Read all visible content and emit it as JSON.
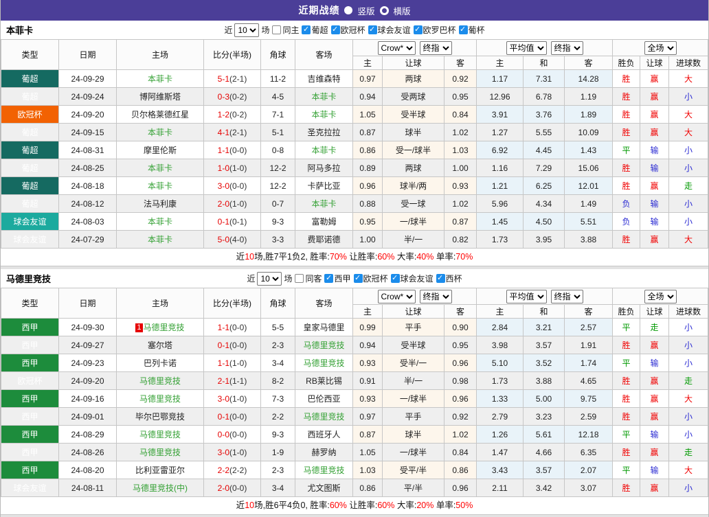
{
  "titlebar": {
    "title": "近期战绩",
    "radio_vertical": "竖版",
    "radio_horizontal": "横版"
  },
  "colors": {
    "titlebar_purple": "#4b3e98",
    "league_pt": "#156a61",
    "ucl_orange": "#f26202",
    "friendly_teal": "#1caa9e",
    "laliga_green": "#1d8c3c",
    "win_red": "#f00000",
    "draw_green": "#009900",
    "lose_blue": "#2a2ad2",
    "score_red": "#e60000",
    "team_green": "#33a033",
    "checkbox_blue": "#1b8ceb",
    "odds_cream_bg": "#fdf6ec",
    "avg_blue_bg": "#e9f3f9",
    "alt_row_bg": "#efefef"
  },
  "common": {
    "filter_prefix": "近",
    "filter_suffix": "场",
    "col_headers": {
      "type": "类型",
      "date": "日期",
      "home": "主场",
      "score": "比分(半场)",
      "corner": "角球",
      "away": "客场",
      "let_home": "主",
      "let": "让球",
      "let_away": "客",
      "avg_home": "主",
      "avg_draw": "和",
      "avg_away": "客",
      "result_wdl": "胜负",
      "result_let": "让球",
      "result_goals": "进球数"
    },
    "selects": {
      "rounds": "10",
      "odds_source": "Crow*",
      "odds_stage": "终指",
      "avg_source": "平均值",
      "avg_stage": "终指",
      "scope": "全场"
    }
  },
  "benfica": {
    "team": "本菲卡",
    "same_label": "同主",
    "leagues": [
      "葡超",
      "欧冠杯",
      "球会友谊",
      "欧罗巴杯",
      "葡杯"
    ],
    "rows": [
      {
        "t": "葡超",
        "tc": "t-pu",
        "d": "24-09-29",
        "h": "本菲卡",
        "hc": "tm-g",
        "bg": "",
        "s": "5-1",
        "hf": "(2-1)",
        "cn": "11-2",
        "a": "吉维森特",
        "ac": "",
        "o1": "0.97",
        "o2": "两球",
        "o3": "0.92",
        "v1": "1.17",
        "v2": "7.31",
        "v3": "14.28",
        "r1": "胜",
        "r1c": "c-r",
        "r2": "赢",
        "r2c": "c-r",
        "r3": "大",
        "r3c": "c-r"
      },
      {
        "t": "葡超",
        "tc": "t-pu",
        "d": "24-09-24",
        "h": "博阿维斯塔",
        "hc": "",
        "bg": "",
        "s": "0-3",
        "hf": "(0-2)",
        "cn": "4-5",
        "a": "本菲卡",
        "ac": "tm-g",
        "o1": "0.94",
        "o2": "受两球",
        "o3": "0.95",
        "v1": "12.96",
        "v2": "6.78",
        "v3": "1.19",
        "r1": "胜",
        "r1c": "c-r",
        "r2": "赢",
        "r2c": "c-r",
        "r3": "小",
        "r3c": "c-b"
      },
      {
        "t": "欧冠杯",
        "tc": "t-ucl",
        "d": "24-09-20",
        "h": "贝尔格莱德红星",
        "hc": "",
        "bg": "",
        "s": "1-2",
        "hf": "(0-2)",
        "cn": "7-1",
        "a": "本菲卡",
        "ac": "tm-g",
        "o1": "1.05",
        "o2": "受半球",
        "o3": "0.84",
        "v1": "3.91",
        "v2": "3.76",
        "v3": "1.89",
        "r1": "胜",
        "r1c": "c-r",
        "r2": "赢",
        "r2c": "c-r",
        "r3": "大",
        "r3c": "c-r"
      },
      {
        "t": "葡超",
        "tc": "t-pu",
        "d": "24-09-15",
        "h": "本菲卡",
        "hc": "tm-g",
        "bg": "",
        "s": "4-1",
        "hf": "(2-1)",
        "cn": "5-1",
        "a": "圣克拉拉",
        "ac": "",
        "o1": "0.87",
        "o2": "球半",
        "o3": "1.02",
        "v1": "1.27",
        "v2": "5.55",
        "v3": "10.09",
        "r1": "胜",
        "r1c": "c-r",
        "r2": "赢",
        "r2c": "c-r",
        "r3": "大",
        "r3c": "c-r"
      },
      {
        "t": "葡超",
        "tc": "t-pu",
        "d": "24-08-31",
        "h": "摩里伦斯",
        "hc": "",
        "bg": "",
        "s": "1-1",
        "hf": "(0-0)",
        "cn": "0-8",
        "a": "本菲卡",
        "ac": "tm-g",
        "o1": "0.86",
        "o2": "受一/球半",
        "o3": "1.03",
        "v1": "6.92",
        "v2": "4.45",
        "v3": "1.43",
        "r1": "平",
        "r1c": "c-g",
        "r2": "输",
        "r2c": "c-b",
        "r3": "小",
        "r3c": "c-b"
      },
      {
        "t": "葡超",
        "tc": "t-pu",
        "d": "24-08-25",
        "h": "本菲卡",
        "hc": "tm-g",
        "bg": "",
        "s": "1-0",
        "hf": "(1-0)",
        "cn": "12-2",
        "a": "阿马多拉",
        "ac": "",
        "o1": "0.89",
        "o2": "两球",
        "o3": "1.00",
        "v1": "1.16",
        "v2": "7.29",
        "v3": "15.06",
        "r1": "胜",
        "r1c": "c-r",
        "r2": "输",
        "r2c": "c-b",
        "r3": "小",
        "r3c": "c-b"
      },
      {
        "t": "葡超",
        "tc": "t-pu",
        "d": "24-08-18",
        "h": "本菲卡",
        "hc": "tm-g",
        "bg": "",
        "s": "3-0",
        "hf": "(0-0)",
        "cn": "12-2",
        "a": "卡萨比亚",
        "ac": "",
        "o1": "0.96",
        "o2": "球半/两",
        "o3": "0.93",
        "v1": "1.21",
        "v2": "6.25",
        "v3": "12.01",
        "r1": "胜",
        "r1c": "c-r",
        "r2": "赢",
        "r2c": "c-r",
        "r3": "走",
        "r3c": "c-g"
      },
      {
        "t": "葡超",
        "tc": "t-pu",
        "d": "24-08-12",
        "h": "法马利康",
        "hc": "",
        "bg": "",
        "s": "2-0",
        "hf": "(1-0)",
        "cn": "0-7",
        "a": "本菲卡",
        "ac": "tm-g",
        "o1": "0.88",
        "o2": "受一球",
        "o3": "1.02",
        "v1": "5.96",
        "v2": "4.34",
        "v3": "1.49",
        "r1": "负",
        "r1c": "c-b",
        "r2": "输",
        "r2c": "c-b",
        "r3": "小",
        "r3c": "c-b"
      },
      {
        "t": "球会友谊",
        "tc": "t-fr",
        "d": "24-08-03",
        "h": "本菲卡",
        "hc": "tm-g",
        "bg": "",
        "s": "0-1",
        "hf": "(0-1)",
        "cn": "9-3",
        "a": "富勒姆",
        "ac": "",
        "o1": "0.95",
        "o2": "一/球半",
        "o3": "0.87",
        "v1": "1.45",
        "v2": "4.50",
        "v3": "5.51",
        "r1": "负",
        "r1c": "c-b",
        "r2": "输",
        "r2c": "c-b",
        "r3": "小",
        "r3c": "c-b"
      },
      {
        "t": "球会友谊",
        "tc": "t-fr",
        "d": "24-07-29",
        "h": "本菲卡",
        "hc": "tm-g",
        "bg": "",
        "s": "5-0",
        "hf": "(4-0)",
        "cn": "3-3",
        "a": "费耶诺德",
        "ac": "",
        "o1": "1.00",
        "o2": "半/一",
        "o3": "0.82",
        "v1": "1.73",
        "v2": "3.95",
        "v3": "3.88",
        "r1": "胜",
        "r1c": "c-r",
        "r2": "赢",
        "r2c": "c-r",
        "r3": "大",
        "r3c": "c-r"
      }
    ],
    "summary": {
      "pre": "近",
      "n": "10",
      "rec": "场,胜7平1负2, 胜率:",
      "v1": "70%",
      "l2": " 让胜率:",
      "v2": "60%",
      "l3": " 大率:",
      "v3": "40%",
      "l4": " 单率:",
      "v4": "70%"
    }
  },
  "atletico": {
    "team": "马德里竞技",
    "same_label": "同客",
    "leagues": [
      "西甲",
      "欧冠杯",
      "球会友谊",
      "西杯"
    ],
    "rows": [
      {
        "t": "西甲",
        "tc": "t-liga",
        "d": "24-09-30",
        "h": "马德里竞技",
        "hc": "tm-g",
        "bg": "1",
        "s": "1-1",
        "hf": "(0-0)",
        "cn": "5-5",
        "a": "皇家马德里",
        "ac": "",
        "o1": "0.99",
        "o2": "平手",
        "o3": "0.90",
        "v1": "2.84",
        "v2": "3.21",
        "v3": "2.57",
        "r1": "平",
        "r1c": "c-g",
        "r2": "走",
        "r2c": "c-g",
        "r3": "小",
        "r3c": "c-b"
      },
      {
        "t": "西甲",
        "tc": "t-liga",
        "d": "24-09-27",
        "h": "塞尔塔",
        "hc": "",
        "bg": "",
        "s": "0-1",
        "hf": "(0-0)",
        "cn": "2-3",
        "a": "马德里竞技",
        "ac": "tm-g",
        "o1": "0.94",
        "o2": "受半球",
        "o3": "0.95",
        "v1": "3.98",
        "v2": "3.57",
        "v3": "1.91",
        "r1": "胜",
        "r1c": "c-r",
        "r2": "赢",
        "r2c": "c-r",
        "r3": "小",
        "r3c": "c-b"
      },
      {
        "t": "西甲",
        "tc": "t-liga",
        "d": "24-09-23",
        "h": "巴列卡诺",
        "hc": "",
        "bg": "",
        "s": "1-1",
        "hf": "(1-0)",
        "cn": "3-4",
        "a": "马德里竞技",
        "ac": "tm-g",
        "o1": "0.93",
        "o2": "受半/一",
        "o3": "0.96",
        "v1": "5.10",
        "v2": "3.52",
        "v3": "1.74",
        "r1": "平",
        "r1c": "c-g",
        "r2": "输",
        "r2c": "c-b",
        "r3": "小",
        "r3c": "c-b"
      },
      {
        "t": "欧冠杯",
        "tc": "t-ucl",
        "d": "24-09-20",
        "h": "马德里竞技",
        "hc": "tm-g",
        "bg": "",
        "s": "2-1",
        "hf": "(1-1)",
        "cn": "8-2",
        "a": "RB莱比锡",
        "ac": "",
        "o1": "0.91",
        "o2": "半/一",
        "o3": "0.98",
        "v1": "1.73",
        "v2": "3.88",
        "v3": "4.65",
        "r1": "胜",
        "r1c": "c-r",
        "r2": "赢",
        "r2c": "c-r",
        "r3": "走",
        "r3c": "c-g"
      },
      {
        "t": "西甲",
        "tc": "t-liga",
        "d": "24-09-16",
        "h": "马德里竞技",
        "hc": "tm-g",
        "bg": "",
        "s": "3-0",
        "hf": "(1-0)",
        "cn": "7-3",
        "a": "巴伦西亚",
        "ac": "",
        "o1": "0.93",
        "o2": "一/球半",
        "o3": "0.96",
        "v1": "1.33",
        "v2": "5.00",
        "v3": "9.75",
        "r1": "胜",
        "r1c": "c-r",
        "r2": "赢",
        "r2c": "c-r",
        "r3": "大",
        "r3c": "c-r"
      },
      {
        "t": "西甲",
        "tc": "t-liga",
        "d": "24-09-01",
        "h": "毕尔巴鄂竞技",
        "hc": "",
        "bg": "",
        "s": "0-1",
        "hf": "(0-0)",
        "cn": "2-2",
        "a": "马德里竞技",
        "ac": "tm-g",
        "o1": "0.97",
        "o2": "平手",
        "o3": "0.92",
        "v1": "2.79",
        "v2": "3.23",
        "v3": "2.59",
        "r1": "胜",
        "r1c": "c-r",
        "r2": "赢",
        "r2c": "c-r",
        "r3": "小",
        "r3c": "c-b"
      },
      {
        "t": "西甲",
        "tc": "t-liga",
        "d": "24-08-29",
        "h": "马德里竞技",
        "hc": "tm-g",
        "bg": "",
        "s": "0-0",
        "hf": "(0-0)",
        "cn": "9-3",
        "a": "西班牙人",
        "ac": "",
        "o1": "0.87",
        "o2": "球半",
        "o3": "1.02",
        "v1": "1.26",
        "v2": "5.61",
        "v3": "12.18",
        "r1": "平",
        "r1c": "c-g",
        "r2": "输",
        "r2c": "c-b",
        "r3": "小",
        "r3c": "c-b"
      },
      {
        "t": "西甲",
        "tc": "t-liga",
        "d": "24-08-26",
        "h": "马德里竞技",
        "hc": "tm-g",
        "bg": "",
        "s": "3-0",
        "hf": "(1-0)",
        "cn": "1-9",
        "a": "赫罗纳",
        "ac": "",
        "o1": "1.05",
        "o2": "一/球半",
        "o3": "0.84",
        "v1": "1.47",
        "v2": "4.66",
        "v3": "6.35",
        "r1": "胜",
        "r1c": "c-r",
        "r2": "赢",
        "r2c": "c-r",
        "r3": "走",
        "r3c": "c-g"
      },
      {
        "t": "西甲",
        "tc": "t-liga",
        "d": "24-08-20",
        "h": "比利亚雷亚尔",
        "hc": "",
        "bg": "",
        "s": "2-2",
        "hf": "(2-2)",
        "cn": "2-3",
        "a": "马德里竞技",
        "ac": "tm-g",
        "o1": "1.03",
        "o2": "受平/半",
        "o3": "0.86",
        "v1": "3.43",
        "v2": "3.57",
        "v3": "2.07",
        "r1": "平",
        "r1c": "c-g",
        "r2": "输",
        "r2c": "c-b",
        "r3": "大",
        "r3c": "c-r"
      },
      {
        "t": "球会友谊",
        "tc": "t-fr",
        "d": "24-08-11",
        "h": "马德里竞技(中)",
        "hc": "tm-g",
        "bg": "",
        "s": "2-0",
        "hf": "(0-0)",
        "cn": "3-4",
        "a": "尤文图斯",
        "ac": "",
        "o1": "0.86",
        "o2": "平/半",
        "o3": "0.96",
        "v1": "2.11",
        "v2": "3.42",
        "v3": "3.07",
        "r1": "胜",
        "r1c": "c-r",
        "r2": "赢",
        "r2c": "c-r",
        "r3": "小",
        "r3c": "c-b"
      }
    ],
    "summary": {
      "pre": "近",
      "n": "10",
      "rec": "场,胜6平4负0, 胜率:",
      "v1": "60%",
      "l2": " 让胜率:",
      "v2": "60%",
      "l3": " 大率:",
      "v3": "20%",
      "l4": " 单率:",
      "v4": "50%"
    }
  }
}
